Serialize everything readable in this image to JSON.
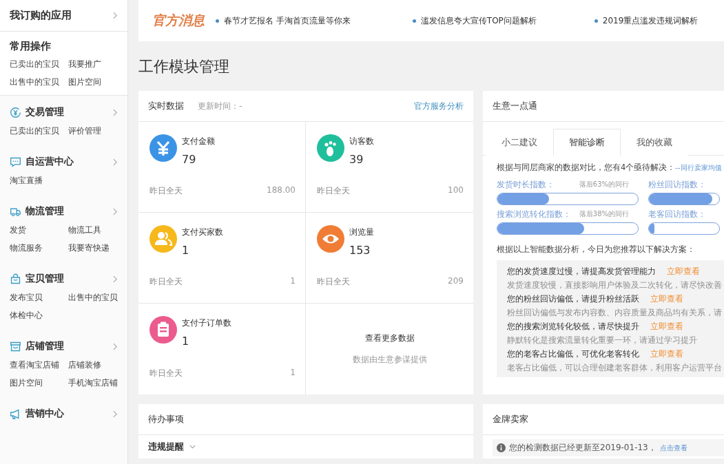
{
  "sidebar": {
    "subscribed": {
      "label": "我订购的应用"
    },
    "common": {
      "title": "常用操作",
      "links": [
        "已卖出的宝贝",
        "我要推广",
        "出售中的宝贝",
        "图片空间"
      ]
    },
    "sections": [
      {
        "title": "交易管理",
        "links": [
          "已卖出的宝贝",
          "评价管理"
        ]
      },
      {
        "title": "自运营中心",
        "links": [
          "淘宝直播"
        ]
      },
      {
        "title": "物流管理",
        "links": [
          "发货",
          "物流工具",
          "物流服务",
          "我要寄快递"
        ]
      },
      {
        "title": "宝贝管理",
        "links": [
          "发布宝贝",
          "出售中的宝贝",
          "体检中心"
        ]
      },
      {
        "title": "店铺管理",
        "links": [
          "查看淘宝店铺",
          "店铺装修",
          "图片空间",
          "手机淘宝店铺"
        ]
      },
      {
        "title": "营销中心"
      }
    ]
  },
  "news": {
    "title": "官方消息",
    "items": [
      "春节才艺报名 手淘首页流量等你来",
      "滥发信息夸大宣传TOP问题解析",
      "2019重点滥发违规词解析"
    ]
  },
  "page_title": "工作模块管理",
  "realtime": {
    "title": "实时数据",
    "update_label": "更新时间：-",
    "link": "官方服务分析",
    "metrics": [
      {
        "color": "#3b93e6",
        "label": "支付金额",
        "value": "79",
        "yesterday_label": "昨日全天",
        "yesterday_value": "188.00"
      },
      {
        "color": "#1fbf9c",
        "label": "访客数",
        "value": "39",
        "yesterday_label": "昨日全天",
        "yesterday_value": "100"
      },
      {
        "color": "#f6b81b",
        "label": "支付买家数",
        "value": "1",
        "yesterday_label": "昨日全天",
        "yesterday_value": "1"
      },
      {
        "color": "#f07c35",
        "label": "浏览量",
        "value": "153",
        "yesterday_label": "昨日全天",
        "yesterday_value": "209"
      },
      {
        "color": "#ec5b8e",
        "label": "支付子订单数",
        "value": "1",
        "yesterday_label": "昨日全天",
        "yesterday_value": "1"
      }
    ],
    "more": {
      "title": "查看更多数据",
      "note": "数据由生意参谋提供"
    }
  },
  "business": {
    "title": "生意一点通",
    "tabs": [
      {
        "label": "小二建议",
        "selected": false
      },
      {
        "label": "智能诊断",
        "selected": true
      },
      {
        "label": "我的收藏",
        "selected": false
      }
    ],
    "intro": "根据与同层商家的数据对比，您有4个亟待解决：",
    "intro_link": "--同行卖家均值",
    "indices": [
      {
        "label": "发货时长指数：",
        "note": "落后63%的同行",
        "level": 0.37
      },
      {
        "label": "粉丝回访指数：",
        "level": 0.9
      },
      {
        "label": "搜索浏览转化指数：",
        "note": "落后38%的同行",
        "level": 0.62
      },
      {
        "label": "老客回访指数：",
        "level": 0.08
      }
    ],
    "recommend_title": "根据以上智能数据分析，今日为您推荐以下解决方案：",
    "solutions": [
      {
        "title": "您的发货速度过慢，请提高发货管理能力",
        "action": "立即查看",
        "desc": "发货速度较慢，直接影响用户体验及二次转化，请尽快改善"
      },
      {
        "title": "您的粉丝回访偏低，请提升粉丝活跃",
        "action": "立即查看",
        "desc": "粉丝回访偏低与发布内容数、内容质量及商品均有关系，请"
      },
      {
        "title": "您的搜索浏览转化较低，请尽快提升",
        "action": "立即查看",
        "desc": "静默转化是搜索流量转化重要一环，请通过学习提升"
      },
      {
        "title": "您的老客占比偏低，可优化老客转化",
        "action": "立即查看",
        "desc": "老客占比偏低，可以合理创建老客群体，利用客户运营平台"
      }
    ]
  },
  "todo": {
    "title": "待办事项",
    "items": [
      {
        "label": "违规提醒"
      }
    ]
  },
  "gold": {
    "title": "金牌卖家",
    "notice": "您的检测数据已经更新至2019-01-13，",
    "notice_link": "点击查看"
  }
}
